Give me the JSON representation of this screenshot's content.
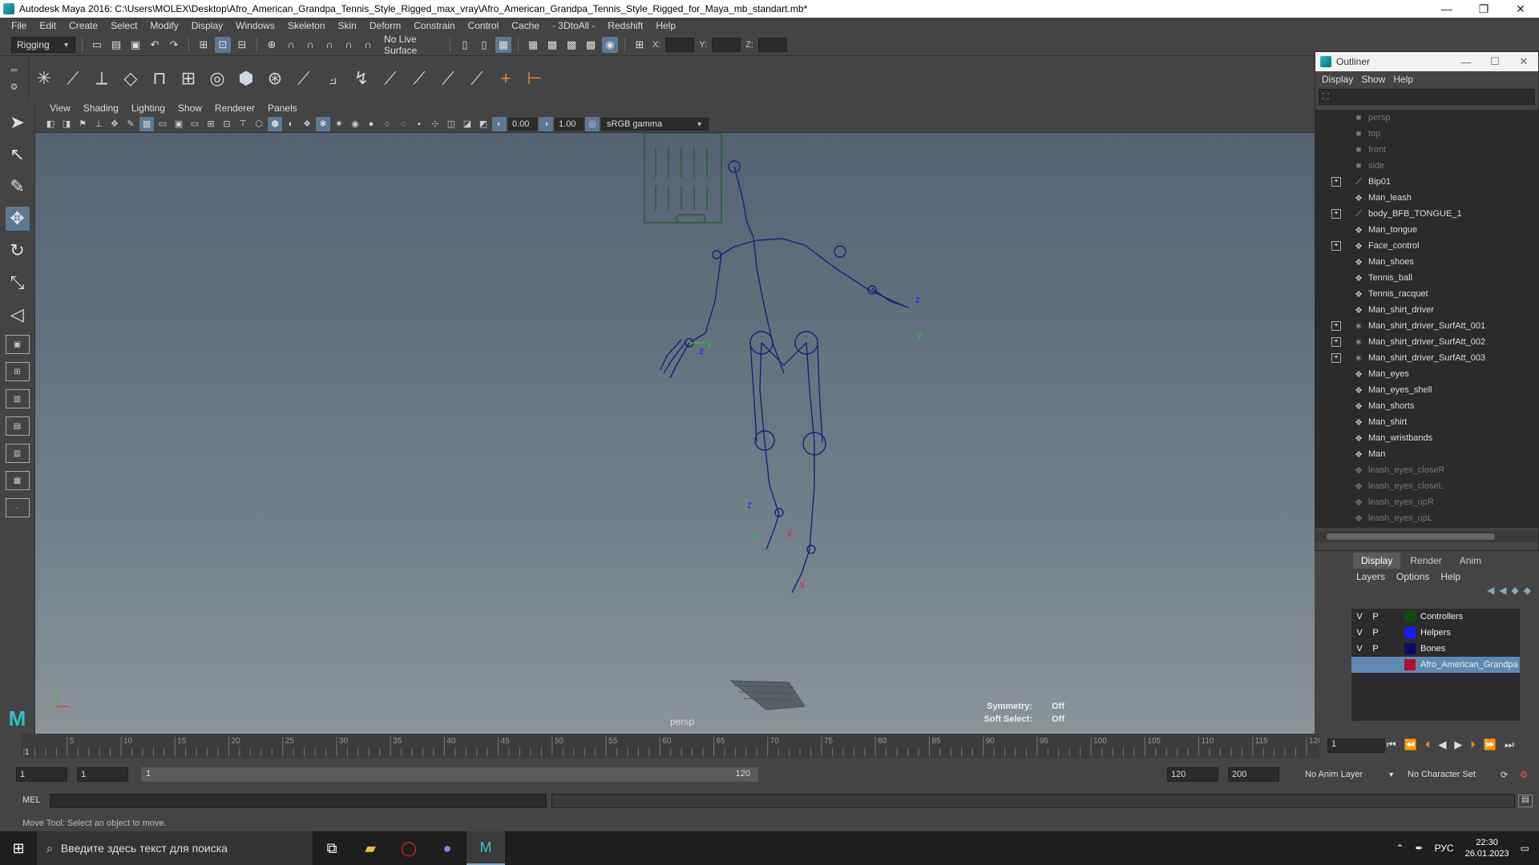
{
  "window": {
    "title": "Autodesk Maya 2016: C:\\Users\\MOLEX\\Desktop\\Afro_American_Grandpa_Tennis_Style_Rigged_max_vray\\Afro_American_Grandpa_Tennis_Style_Rigged_for_Maya_mb_standart.mb*"
  },
  "menubar": {
    "items": [
      "File",
      "Edit",
      "Create",
      "Select",
      "Modify",
      "Display",
      "Windows",
      "Skeleton",
      "Skin",
      "Deform",
      "Constrain",
      "Control",
      "Cache",
      "- 3DtoAll -",
      "Redshift",
      "Help"
    ]
  },
  "statusline": {
    "mode": "Rigging",
    "live_surface": "No Live Surface",
    "x_label": "X:",
    "y_label": "Y:",
    "z_label": "Z:"
  },
  "panel": {
    "menu": [
      "View",
      "Shading",
      "Lighting",
      "Show",
      "Renderer",
      "Panels"
    ],
    "field_a": "0.00",
    "field_b": "1.00",
    "color_space": "sRGB gamma",
    "camera_label": "persp",
    "symmetry_label": "Symmetry:",
    "symmetry_value": "Off",
    "soft_select_label": "Soft Select:",
    "soft_select_value": "Off"
  },
  "outliner": {
    "title": "Outliner",
    "menu": [
      "Display",
      "Show",
      "Help"
    ],
    "items": [
      {
        "label": "persp",
        "icon": "camera-icon",
        "expand": false,
        "dim": true
      },
      {
        "label": "top",
        "icon": "camera-icon",
        "expand": false,
        "dim": true
      },
      {
        "label": "front",
        "icon": "camera-icon",
        "expand": false,
        "dim": true
      },
      {
        "label": "side",
        "icon": "camera-icon",
        "expand": false,
        "dim": true
      },
      {
        "label": "Bip01",
        "icon": "joint-icon",
        "expand": true,
        "dim": false
      },
      {
        "label": "Man_leash",
        "icon": "mesh-icon",
        "expand": false,
        "dim": false
      },
      {
        "label": "body_BFB_TONGUE_1",
        "icon": "joint-icon",
        "expand": true,
        "dim": false
      },
      {
        "label": "Man_tongue",
        "icon": "mesh-icon",
        "expand": false,
        "dim": false
      },
      {
        "label": "Face_control",
        "icon": "mesh-icon",
        "expand": true,
        "dim": false
      },
      {
        "label": "Man_shoes",
        "icon": "mesh-icon",
        "expand": false,
        "dim": false
      },
      {
        "label": "Tennis_ball",
        "icon": "mesh-icon",
        "expand": false,
        "dim": false
      },
      {
        "label": "Tennis_racquet",
        "icon": "mesh-icon",
        "expand": false,
        "dim": false
      },
      {
        "label": "Man_shirt_driver",
        "icon": "mesh-icon",
        "expand": false,
        "dim": false
      },
      {
        "label": "Man_shirt_driver_SurfAtt_001",
        "icon": "locator-icon",
        "expand": true,
        "dim": false
      },
      {
        "label": "Man_shirt_driver_SurfAtt_002",
        "icon": "locator-icon",
        "expand": true,
        "dim": false
      },
      {
        "label": "Man_shirt_driver_SurfAtt_003",
        "icon": "locator-icon",
        "expand": true,
        "dim": false
      },
      {
        "label": "Man_eyes",
        "icon": "mesh-icon",
        "expand": false,
        "dim": false
      },
      {
        "label": "Man_eyes_shell",
        "icon": "mesh-icon",
        "expand": false,
        "dim": false
      },
      {
        "label": "Man_shorts",
        "icon": "mesh-icon",
        "expand": false,
        "dim": false
      },
      {
        "label": "Man_shirt",
        "icon": "mesh-icon",
        "expand": false,
        "dim": false
      },
      {
        "label": "Man_wristbands",
        "icon": "mesh-icon",
        "expand": false,
        "dim": false
      },
      {
        "label": "Man",
        "icon": "mesh-icon",
        "expand": false,
        "dim": false
      },
      {
        "label": "leash_eyes_closeR",
        "icon": "mesh-icon",
        "expand": false,
        "dim": true
      },
      {
        "label": "leash_eyes_closeL",
        "icon": "mesh-icon",
        "expand": false,
        "dim": true
      },
      {
        "label": "leash_eyes_upR",
        "icon": "mesh-icon",
        "expand": false,
        "dim": true
      },
      {
        "label": "leash_eyes_upL",
        "icon": "mesh-icon",
        "expand": false,
        "dim": true
      }
    ]
  },
  "layer_editor": {
    "tabs": [
      "Display",
      "Render",
      "Anim"
    ],
    "menu": [
      "Layers",
      "Options",
      "Help"
    ],
    "layers": [
      {
        "v": "V",
        "p": "P",
        "name": "Controllers",
        "color": "#0b4d1a",
        "selected": false
      },
      {
        "v": "V",
        "p": "P",
        "name": "Helpers",
        "color": "#1a1aff",
        "selected": false
      },
      {
        "v": "V",
        "p": "P",
        "name": "Bones",
        "color": "#0a0a6a",
        "selected": false
      },
      {
        "v": "",
        "p": "",
        "name": "Afro_American_Grandpa",
        "color": "#b0102a",
        "selected": true
      }
    ]
  },
  "timeline": {
    "ticks": [
      "5",
      "10",
      "15",
      "20",
      "25",
      "30",
      "35",
      "40",
      "45",
      "50",
      "55",
      "60",
      "65",
      "70",
      "75",
      "80",
      "85",
      "90",
      "95",
      "100",
      "105",
      "110",
      "115",
      "120"
    ],
    "start_marker": "1",
    "current_frame": "1"
  },
  "range": {
    "start": "1",
    "playback_start": "1",
    "bar_start": "1",
    "bar_end": "120",
    "playback_end": "120",
    "end": "200",
    "anim_layer": "No Anim Layer",
    "character_set": "No Character Set"
  },
  "cmdline": {
    "label": "MEL"
  },
  "helpline": {
    "text": "Move Tool: Select an object to move."
  },
  "taskbar": {
    "search_placeholder": "Введите здесь текст для поиска",
    "language": "РУС",
    "time": "22:30",
    "date": "26.01.2023"
  },
  "colors": {
    "accent": "#5d7891",
    "rig_blue": "#1b1f7a",
    "controller_green": "#1d5b2a"
  }
}
